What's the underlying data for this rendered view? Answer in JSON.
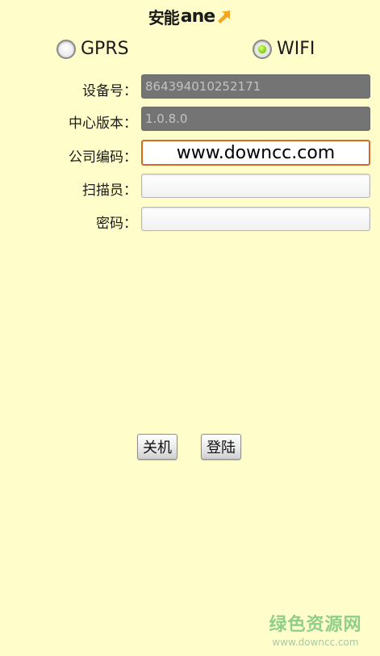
{
  "header": {
    "logo_cn": "安能",
    "logo_en": "ane"
  },
  "network": {
    "options": [
      {
        "label": "GPRS",
        "selected": false
      },
      {
        "label": "WIFI",
        "selected": true
      }
    ],
    "accent_color": "#8bd11c"
  },
  "form": {
    "device_no": {
      "label": "设备号：",
      "value": "864394010252171"
    },
    "center_version": {
      "label": "中心版本：",
      "value": "1.0.8.0"
    },
    "company_code": {
      "label": "公司编码：",
      "value": "www.downcc.com"
    },
    "scanner": {
      "label": "扫描员：",
      "value": ""
    },
    "password": {
      "label": "密码：",
      "value": ""
    }
  },
  "buttons": {
    "shutdown_label": "关机",
    "login_label": "登陆"
  },
  "watermark": {
    "title": "绿色资源网",
    "url": "www.downcc.com"
  },
  "colors": {
    "background": "#fffecb",
    "focus_border": "#d16a2c",
    "disabled_field": "#747474",
    "logo_arrow": "#f5a623"
  }
}
